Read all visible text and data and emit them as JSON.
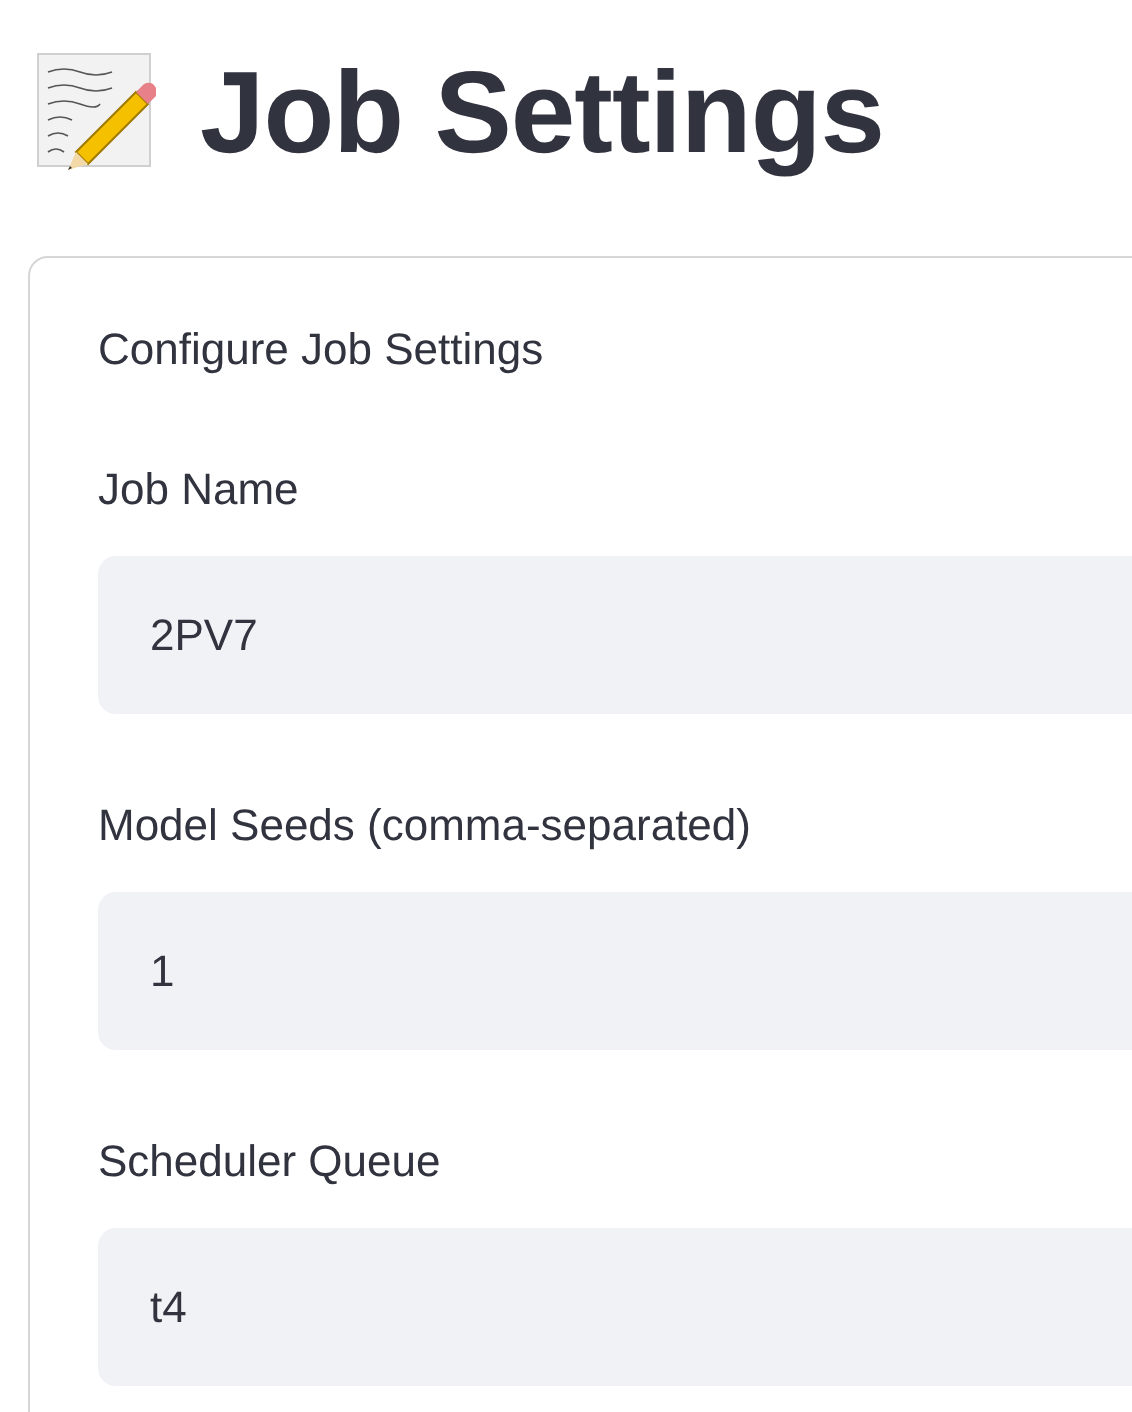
{
  "header": {
    "title": "Job Settings"
  },
  "form": {
    "caption": "Configure Job Settings",
    "fields": [
      {
        "label": "Job Name",
        "value": "2PV7"
      },
      {
        "label": "Model Seeds (comma-separated)",
        "value": "1"
      },
      {
        "label": "Scheduler Queue",
        "value": "t4"
      }
    ]
  }
}
